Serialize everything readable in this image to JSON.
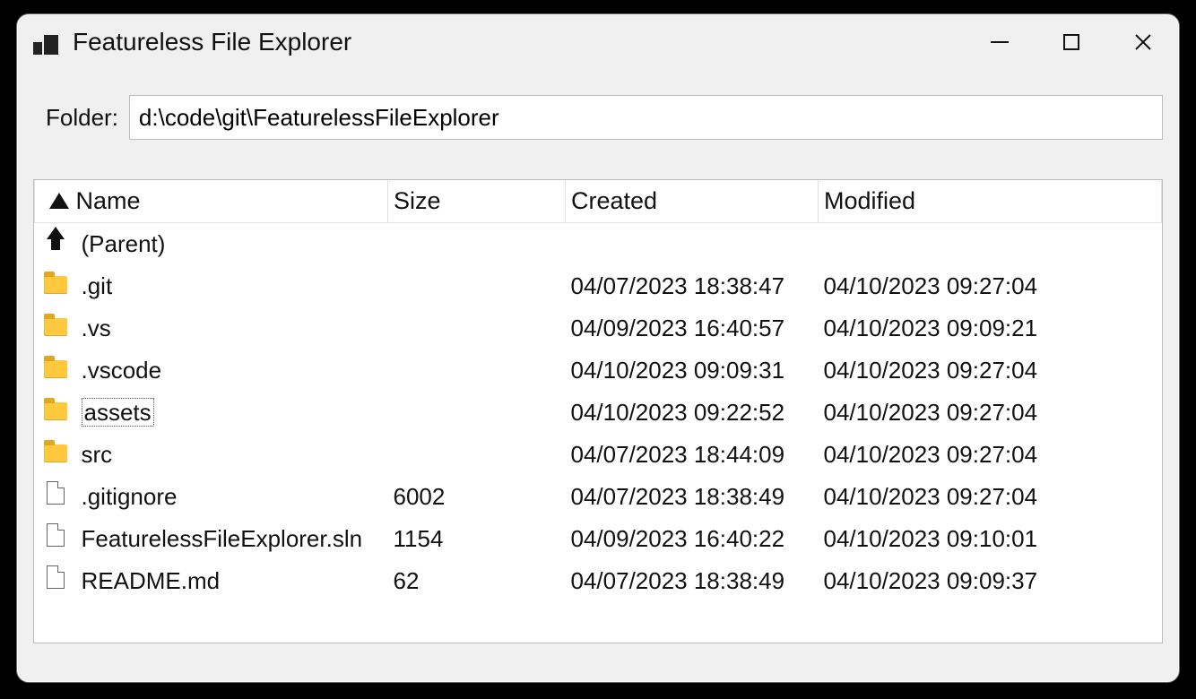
{
  "window": {
    "title": "Featureless File Explorer"
  },
  "path": {
    "label": "Folder:",
    "value": "d:\\code\\git\\FeaturelessFileExplorer"
  },
  "columns": {
    "name": "Name",
    "size": "Size",
    "created": "Created",
    "modified": "Modified"
  },
  "parent_row": {
    "label": "(Parent)"
  },
  "rows": [
    {
      "type": "folder",
      "name": ".git",
      "size": "",
      "created": "04/07/2023 18:38:47",
      "modified": "04/10/2023 09:27:04",
      "focused": false
    },
    {
      "type": "folder",
      "name": ".vs",
      "size": "",
      "created": "04/09/2023 16:40:57",
      "modified": "04/10/2023 09:09:21",
      "focused": false
    },
    {
      "type": "folder",
      "name": ".vscode",
      "size": "",
      "created": "04/10/2023 09:09:31",
      "modified": "04/10/2023 09:27:04",
      "focused": false
    },
    {
      "type": "folder",
      "name": "assets",
      "size": "",
      "created": "04/10/2023 09:22:52",
      "modified": "04/10/2023 09:27:04",
      "focused": true
    },
    {
      "type": "folder",
      "name": "src",
      "size": "",
      "created": "04/07/2023 18:44:09",
      "modified": "04/10/2023 09:27:04",
      "focused": false
    },
    {
      "type": "file",
      "name": ".gitignore",
      "size": "6002",
      "created": "04/07/2023 18:38:49",
      "modified": "04/10/2023 09:27:04",
      "focused": false
    },
    {
      "type": "file",
      "name": "FeaturelessFileExplorer.sln",
      "size": "1154",
      "created": "04/09/2023 16:40:22",
      "modified": "04/10/2023 09:10:01",
      "focused": false
    },
    {
      "type": "file",
      "name": "README.md",
      "size": "62",
      "created": "04/07/2023 18:38:49",
      "modified": "04/10/2023 09:09:37",
      "focused": false
    }
  ]
}
